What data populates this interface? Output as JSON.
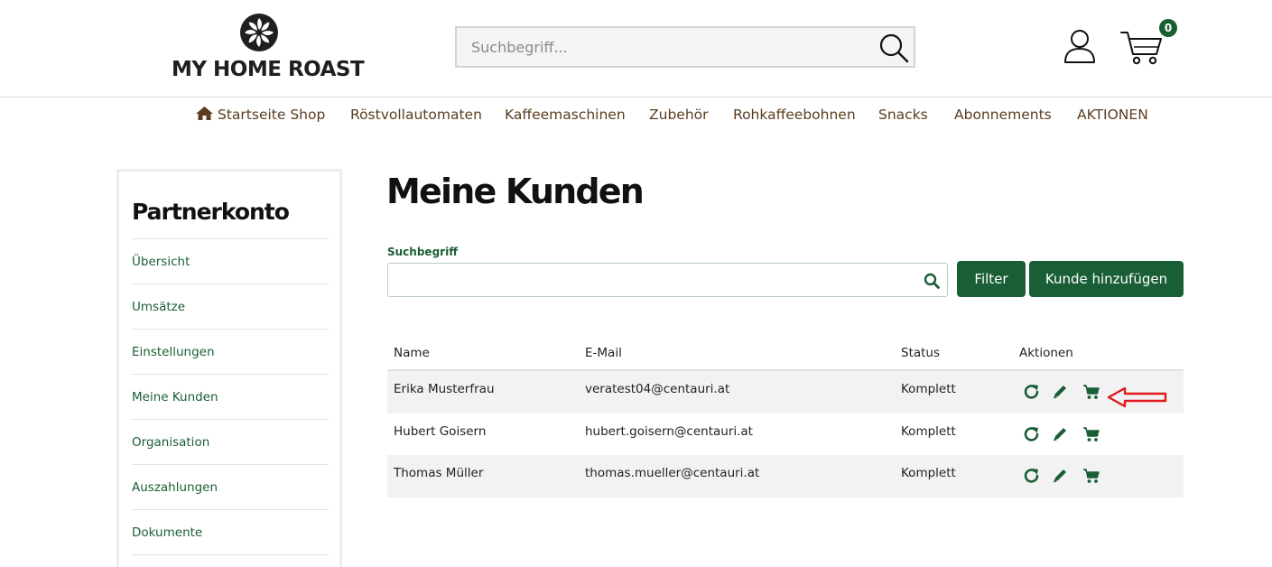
{
  "brand": {
    "logo_text": "MY HOME ROAST",
    "logo_icon": "coffee-swirl-logo-icon"
  },
  "header": {
    "search_placeholder": "Suchbegriff...",
    "search_icon": "search-icon",
    "user_icon": "user-icon",
    "cart_icon": "cart-icon",
    "cart_count": "0"
  },
  "nav": {
    "items": [
      {
        "label": "Startseite Shop",
        "icon": "home-icon"
      },
      {
        "label": "Röstvollautomaten"
      },
      {
        "label": "Kaffeemaschinen"
      },
      {
        "label": "Zubehör"
      },
      {
        "label": "Rohkaffeebohnen"
      },
      {
        "label": "Snacks"
      },
      {
        "label": "Abonnements"
      },
      {
        "label": "AKTIONEN"
      }
    ]
  },
  "sidebar": {
    "title": "Partnerkonto",
    "items": [
      {
        "label": "Übersicht"
      },
      {
        "label": "Umsätze"
      },
      {
        "label": "Einstellungen"
      },
      {
        "label": "Meine Kunden"
      },
      {
        "label": "Organisation"
      },
      {
        "label": "Auszahlungen"
      },
      {
        "label": "Dokumente"
      }
    ]
  },
  "main": {
    "title": "Meine Kunden",
    "filter_label": "Suchbegriff",
    "filter_value": "",
    "filter_button": "Filter",
    "add_button": "Kunde hinzufügen",
    "table": {
      "columns": [
        "Name",
        "E-Mail",
        "Status",
        "Aktionen"
      ],
      "rows": [
        {
          "name": "Erika Musterfrau",
          "email": "veratest04@centauri.at",
          "status": "Komplett"
        },
        {
          "name": "Hubert Goisern",
          "email": "hubert.goisern@centauri.at",
          "status": "Komplett"
        },
        {
          "name": "Thomas Müller",
          "email": "thomas.mueller@centauri.at",
          "status": "Komplett"
        }
      ],
      "action_icons": [
        "refresh-icon",
        "pencil-icon",
        "cart-icon"
      ]
    }
  },
  "colors": {
    "accent_green": "#1a5e35",
    "nav_brown": "#5a3d1f",
    "annotation_red": "#e0191e"
  }
}
